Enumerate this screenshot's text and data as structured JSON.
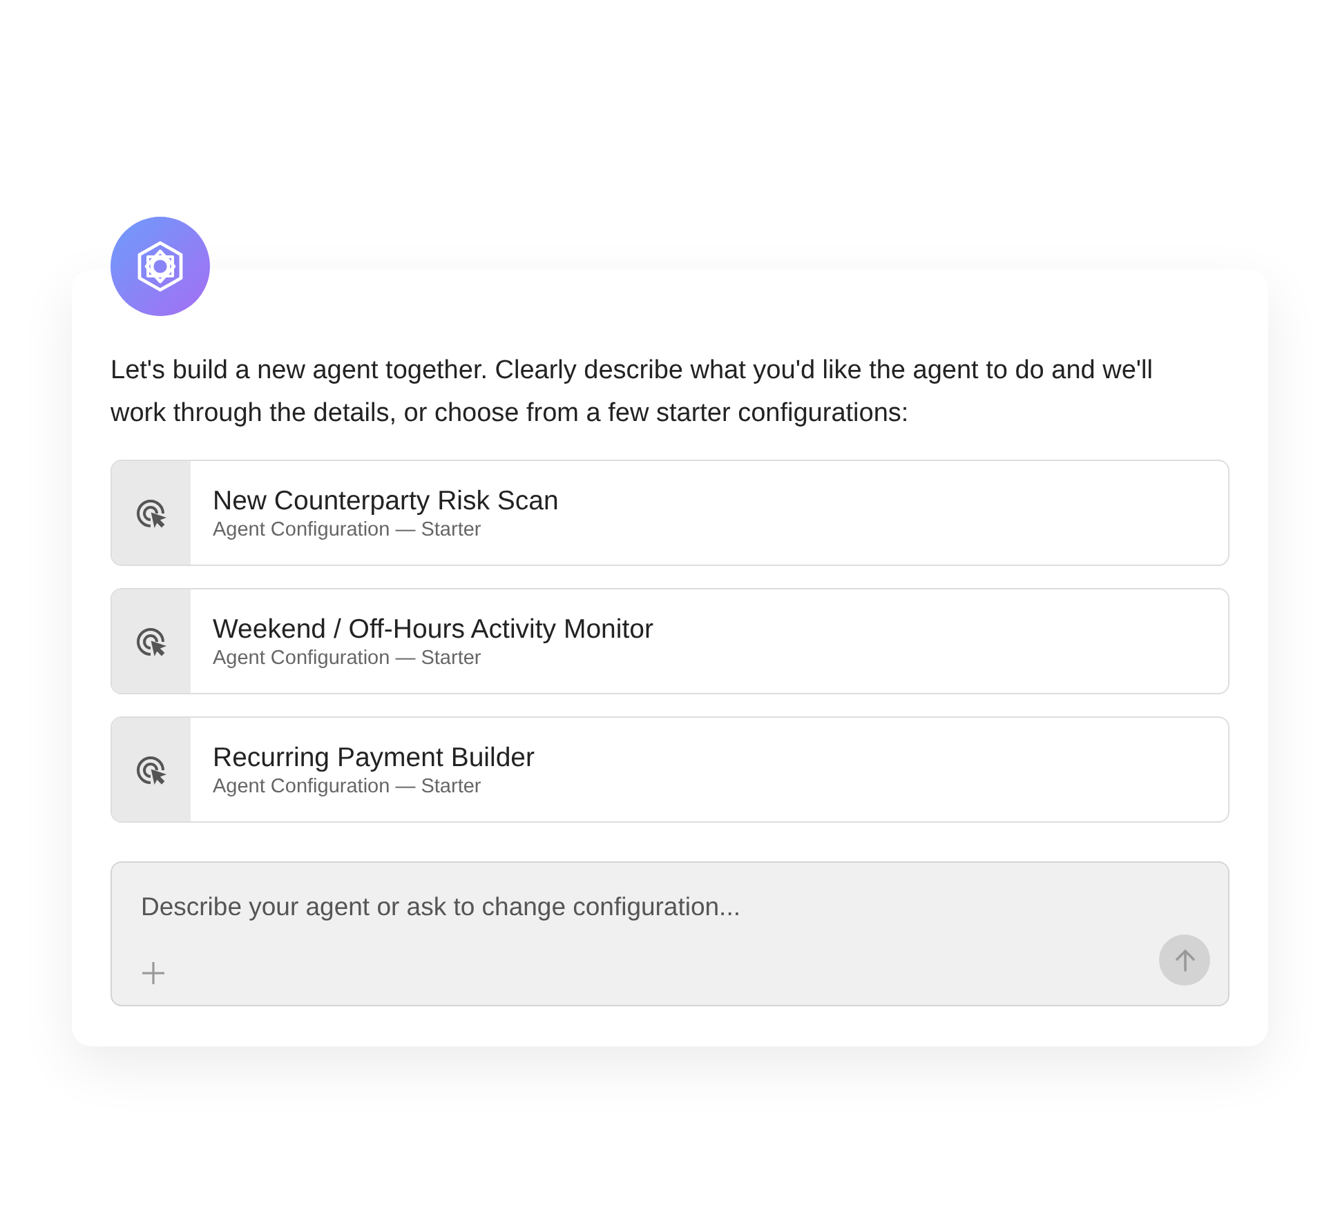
{
  "intro": "Let's build a new agent together. Clearly describe what you'd like the agent to do and we'll work through the details, or choose from a few starter configurations:",
  "options": [
    {
      "title": "New Counterparty Risk Scan",
      "subtitle": "Agent Configuration — Starter"
    },
    {
      "title": "Weekend / Off-Hours Activity Monitor",
      "subtitle": "Agent Configuration — Starter"
    },
    {
      "title": "Recurring Payment Builder",
      "subtitle": "Agent Configuration — Starter"
    }
  ],
  "composer": {
    "placeholder": "Describe your agent or ask to change configuration...",
    "send_disabled": true
  }
}
